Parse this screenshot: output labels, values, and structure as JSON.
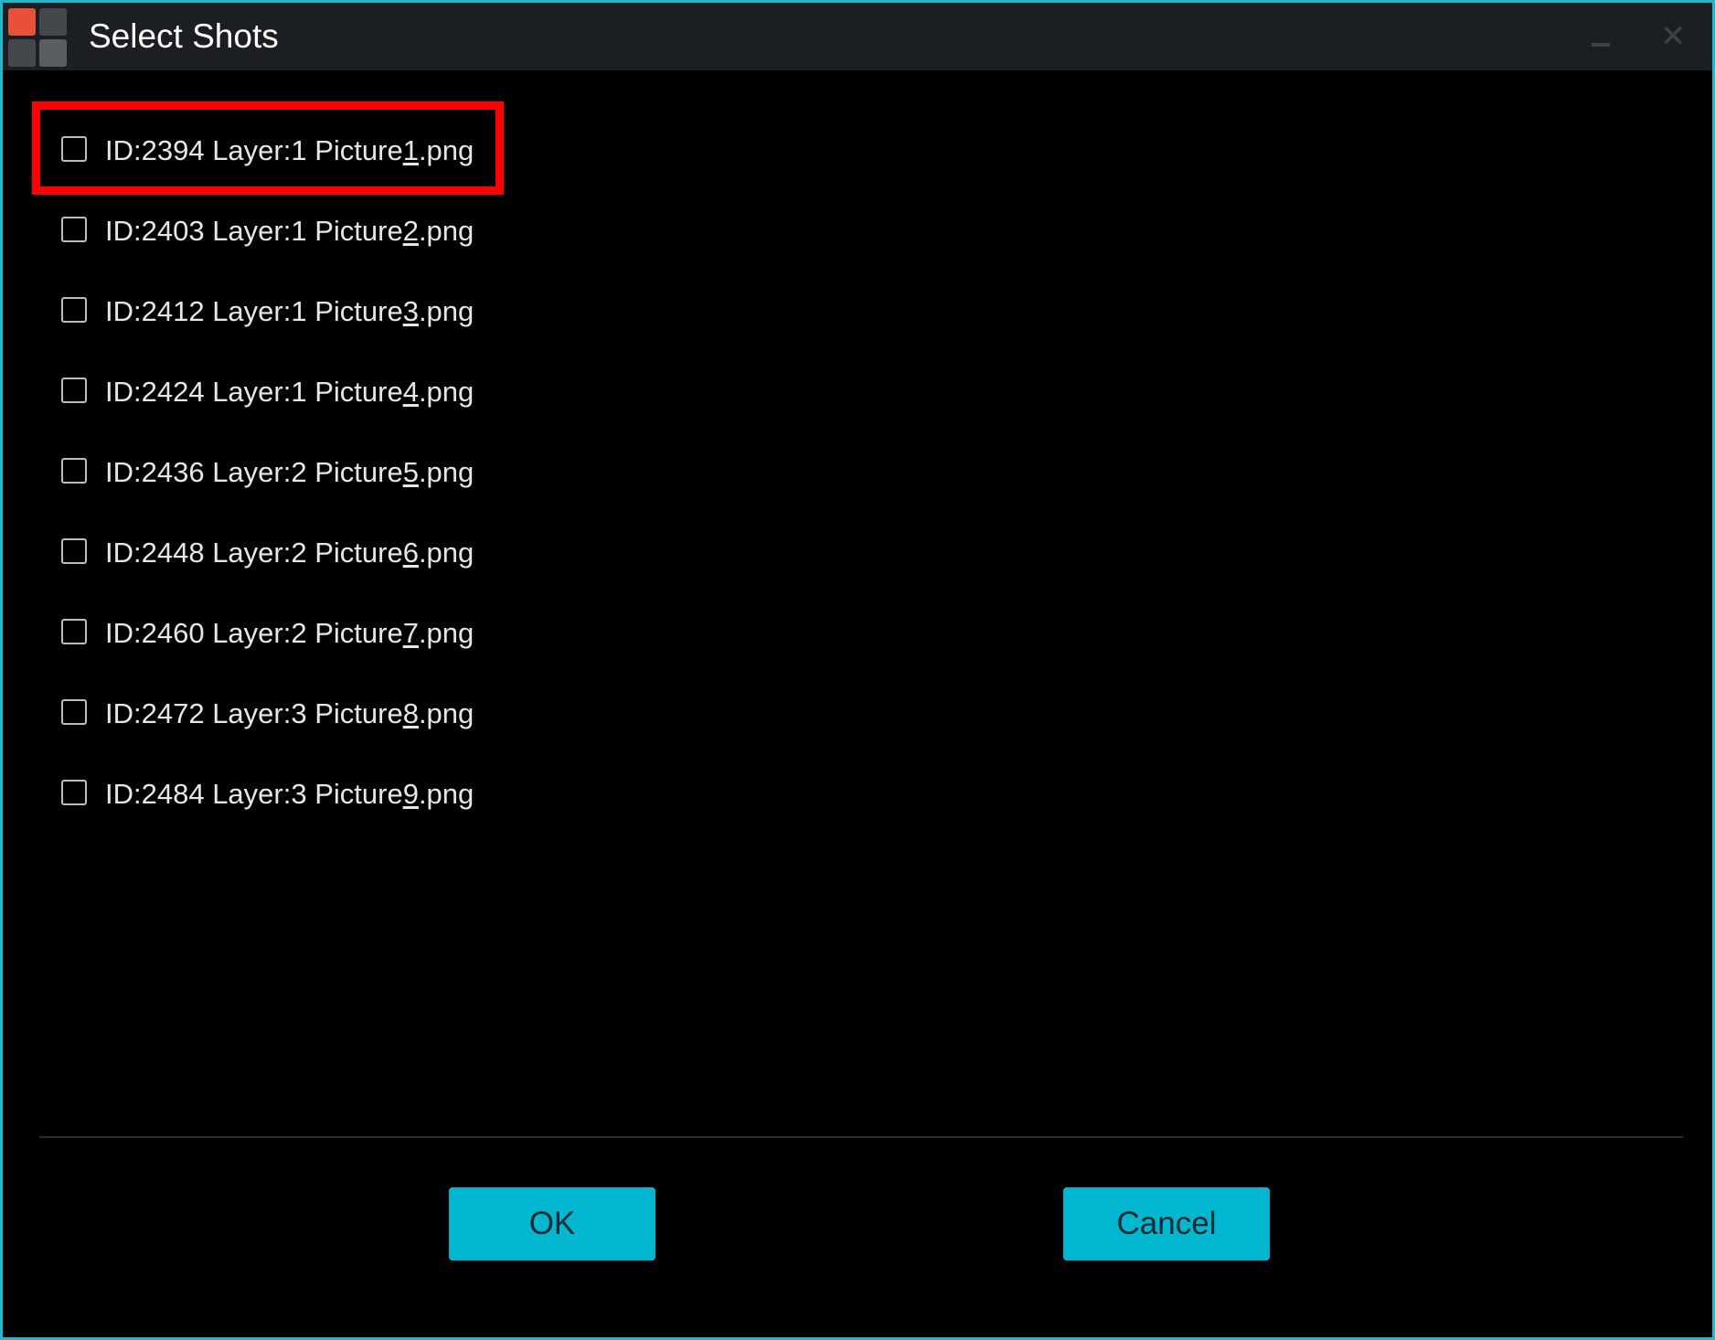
{
  "window": {
    "title": "Select Shots",
    "icons": {
      "app": "app-logo-icon",
      "minimize": "minimize-icon",
      "close": "close-icon"
    },
    "close_glyph": "✕"
  },
  "shots": [
    {
      "prefix": "ID:2394 Layer:1 Picture",
      "mnemonic": "1",
      "suffix": ".png",
      "checked": false
    },
    {
      "prefix": "ID:2403 Layer:1 Picture",
      "mnemonic": "2",
      "suffix": ".png",
      "checked": false
    },
    {
      "prefix": "ID:2412 Layer:1 Picture",
      "mnemonic": "3",
      "suffix": ".png",
      "checked": false
    },
    {
      "prefix": "ID:2424 Layer:1 Picture",
      "mnemonic": "4",
      "suffix": ".png",
      "checked": false
    },
    {
      "prefix": "ID:2436 Layer:2 Picture",
      "mnemonic": "5",
      "suffix": ".png",
      "checked": false
    },
    {
      "prefix": "ID:2448 Layer:2 Picture",
      "mnemonic": "6",
      "suffix": ".png",
      "checked": false
    },
    {
      "prefix": "ID:2460 Layer:2 Picture",
      "mnemonic": "7",
      "suffix": ".png",
      "checked": false
    },
    {
      "prefix": "ID:2472 Layer:3 Picture",
      "mnemonic": "8",
      "suffix": ".png",
      "checked": false
    },
    {
      "prefix": "ID:2484 Layer:3 Picture",
      "mnemonic": "9",
      "suffix": ".png",
      "checked": false
    }
  ],
  "buttons": {
    "ok": "OK",
    "cancel": "Cancel"
  },
  "colors": {
    "accent": "#00b7cf",
    "window_border": "#22b8cc",
    "highlight": "#ff0000",
    "background": "#000000"
  }
}
